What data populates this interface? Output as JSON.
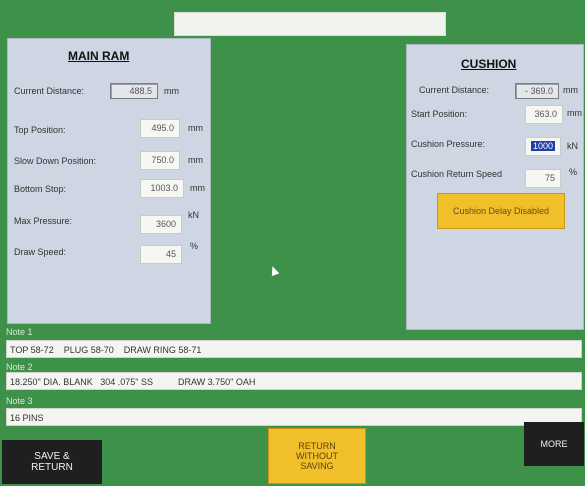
{
  "main_ram": {
    "title": "MAIN RAM",
    "current_distance": {
      "label": "Current Distance:",
      "value": "488.5",
      "unit": "mm"
    },
    "top_position": {
      "label": "Top Position:",
      "value": "495.0",
      "unit": "mm"
    },
    "slow_down_position": {
      "label": "Slow Down Position:",
      "value": "750.0",
      "unit": "mm"
    },
    "bottom_stop": {
      "label": "Bottom Stop:",
      "value": "1003.0",
      "unit": "mm"
    },
    "max_pressure": {
      "label": "Max Pressure:",
      "value": "3600",
      "unit": "kN"
    },
    "draw_speed": {
      "label": "Draw Speed:",
      "value": "45",
      "unit": "%"
    }
  },
  "cushion": {
    "title": "CUSHION",
    "current_distance": {
      "label": "Current Distance:",
      "value": "- 369.0",
      "unit": "mm"
    },
    "start_position": {
      "label": "Start Position:",
      "value": "363.0",
      "unit": "mm"
    },
    "cushion_pressure": {
      "label": "Cushion Pressure:",
      "value": "1000",
      "unit": "kN"
    },
    "cushion_return_speed": {
      "label": "Cushion Return Speed",
      "value": "75",
      "unit": "%"
    },
    "delay_button": "Cushion Delay Disabled"
  },
  "notes": [
    {
      "header": "Note 1",
      "text": "TOP 58-72    PLUG 58-70    DRAW RING 58-71"
    },
    {
      "header": "Note 2",
      "text": "18.250\" DIA. BLANK   304 .075\" SS          DRAW 3.750\" OAH"
    },
    {
      "header": "Note 3",
      "text": "16 PINS"
    }
  ],
  "buttons": {
    "save_return_line1": "SAVE &",
    "save_return_line2": "RETURN",
    "return_without_saving_line1": "RETURN",
    "return_without_saving_line2": "WITHOUT",
    "return_without_saving_line3": "SAVING",
    "more": "MORE"
  },
  "colors": {
    "background_green": "#3d9148",
    "panel_gray_blue": "#cdd6e2",
    "accent_yellow": "#f0bf2a",
    "button_dark": "#1f1f1f"
  }
}
